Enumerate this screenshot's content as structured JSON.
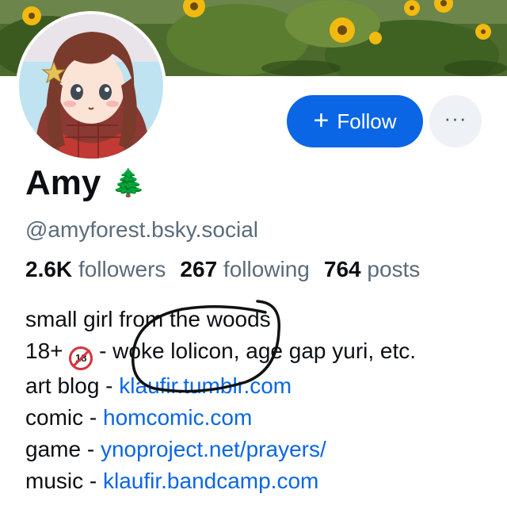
{
  "profile": {
    "display_name": "Amy",
    "name_emoji": "🌲",
    "handle": "@amyforest.bsky.social",
    "avatar_icon": "anime-girl-avatar-icon",
    "banner_icon": "sunflower-field-banner"
  },
  "actions": {
    "follow_label": "Follow",
    "follow_icon": "+",
    "more_icon": "···"
  },
  "stats": {
    "followers_count": "2.6K",
    "followers_label": "followers",
    "following_count": "267",
    "following_label": "following",
    "posts_count": "764",
    "posts_label": "posts"
  },
  "bio": {
    "line1": "small girl from the woods",
    "line2_prefix": "18+",
    "line2_icon": "no-under-18-icon",
    "line2_rest": "- woke lolicon, age gap yuri, etc.",
    "line3_prefix": "art blog - ",
    "line3_link": "klaufir.tumblr.com",
    "line4_prefix": "comic - ",
    "line4_link": "homcomic.com",
    "line5_prefix": "game - ",
    "line5_link": "ynoproject.net/prayers/",
    "line6_prefix": "music - ",
    "line6_link": "klaufir.bandcamp.com"
  },
  "colors": {
    "accent": "#0a66e4",
    "muted_text": "#5c6b7a",
    "more_button_bg": "#eef1f5"
  }
}
